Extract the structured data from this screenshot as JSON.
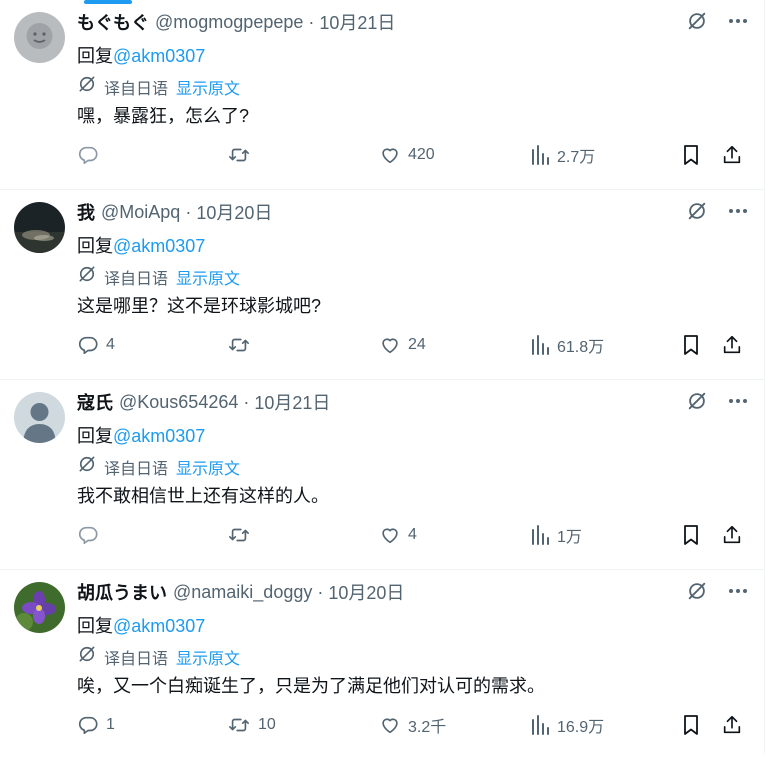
{
  "translate_label": "译自日语",
  "translate_link": "显示原文",
  "tweets": [
    {
      "name": "もぐもぐ",
      "handle": "@mogmogpepepe",
      "dot": "·",
      "date": "10月21日",
      "reply_prefix": "回复",
      "reply_mention": "@akm0307",
      "text": "嘿，暴露狂，怎么了?",
      "replies": "",
      "retweets": "",
      "likes": "420",
      "views": "2.7万",
      "avatar": "smiley-avatar"
    },
    {
      "name": "我",
      "handle": "@MoiApq",
      "dot": "·",
      "date": "10月20日",
      "reply_prefix": "回复",
      "reply_mention": "@akm0307",
      "text": "这是哪里？这不是环球影城吧?",
      "replies": "4",
      "retweets": "",
      "likes": "24",
      "views": "61.8万",
      "avatar": "night-photo-avatar"
    },
    {
      "name": "寇氏",
      "handle": "@Kous654264",
      "dot": "·",
      "date": "10月21日",
      "reply_prefix": "回复",
      "reply_mention": "@akm0307",
      "text": "我不敢相信世上还有这样的人。",
      "replies": "",
      "retweets": "",
      "likes": "4",
      "views": "1万",
      "avatar": "default-person-avatar"
    },
    {
      "name": "胡瓜うまい",
      "handle": "@namaiki_doggy",
      "dot": "·",
      "date": "10月20日",
      "reply_prefix": "回复",
      "reply_mention": "@akm0307",
      "text": "唉，又一个白痴诞生了，只是为了满足他们对认可的需求。",
      "replies": "1",
      "retweets": "10",
      "likes": "3.2千",
      "views": "16.9万",
      "avatar": "purple-flower-avatar"
    }
  ],
  "colors": {
    "accent": "#1d9bf0",
    "text": "#0f1419",
    "muted": "#536471",
    "divider": "#eff3f4"
  }
}
